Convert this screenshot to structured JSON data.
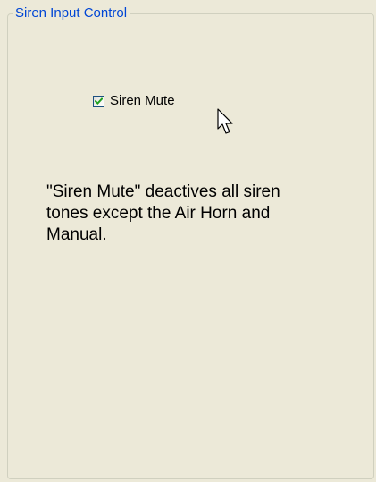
{
  "group": {
    "title": "Siren Input Control"
  },
  "siren_mute": {
    "label": "Siren Mute",
    "checked": true
  },
  "description": {
    "text": "\"Siren Mute\" deactives all siren tones except the Air Horn and Manual."
  },
  "icons": {
    "checkbox": "checkmark-icon",
    "cursor": "mouse-pointer-icon"
  },
  "colors": {
    "panel_background": "#ECE9D8",
    "group_title": "#0046D5",
    "checkmark": "#21A121",
    "group_border": "#D0D0BF"
  }
}
